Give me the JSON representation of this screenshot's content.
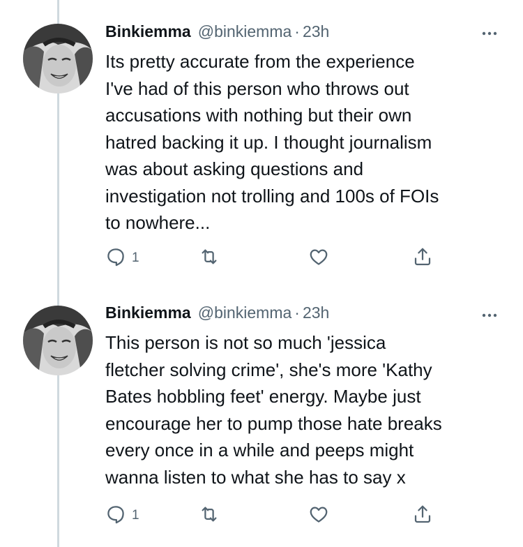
{
  "colors": {
    "text_primary": "#0f1419",
    "text_secondary": "#536471",
    "thread_line": "#cfd9de",
    "background": "#ffffff"
  },
  "tweets": [
    {
      "author_name": "Binkiemma",
      "author_handle": "@binkiemma",
      "separator": "·",
      "time": "23h",
      "text": "Its pretty accurate from the experience\nI've had of this person who throws out\naccusations with nothing but their own\nhatred backing it up. I thought journalism\nwas about asking questions and\ninvestigation not trolling and 100s of FOIs\nto nowhere...",
      "reply_count": "1",
      "icons": [
        "reply-icon",
        "retweet-icon",
        "like-icon",
        "share-icon",
        "more-icon"
      ]
    },
    {
      "author_name": "Binkiemma",
      "author_handle": "@binkiemma",
      "separator": "·",
      "time": "23h",
      "text": "This person is not so much 'jessica\nfletcher solving crime', she's more 'Kathy\nBates hobbling feet' energy. Maybe just\nencourage her to pump those hate breaks\nevery once in a while and peeps might\nwanna listen to what she has to say x",
      "reply_count": "1",
      "icons": [
        "reply-icon",
        "retweet-icon",
        "like-icon",
        "share-icon",
        "more-icon"
      ]
    }
  ]
}
